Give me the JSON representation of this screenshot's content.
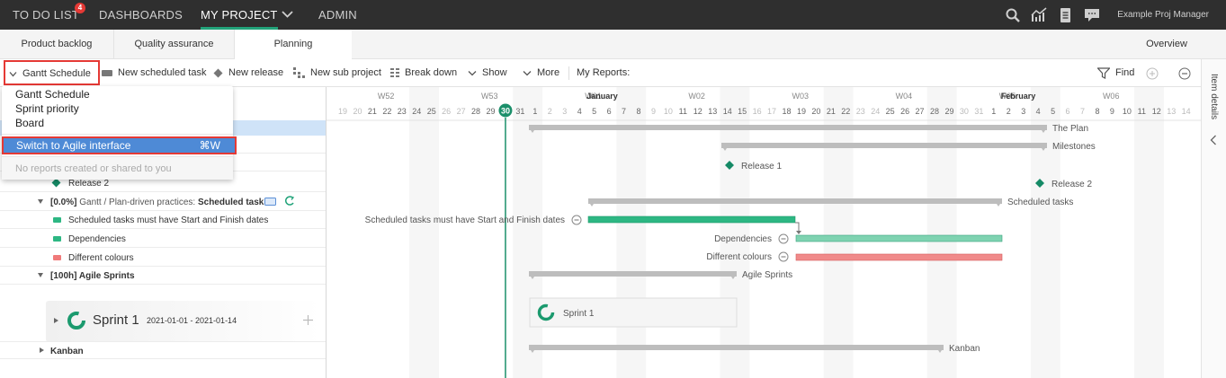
{
  "topbar": {
    "todo": "TO DO LIST",
    "todo_badge": "4",
    "dashboards": "DASHBOARDS",
    "my_project": "MY PROJECT",
    "admin": "ADMIN",
    "user": "Example Proj Manager",
    "icons": [
      "search-icon",
      "analytics-icon",
      "document-icon",
      "chat-icon"
    ],
    "accent": "#22a37a"
  },
  "tabs": [
    "Product backlog",
    "Quality assurance",
    "Planning",
    "Overview"
  ],
  "active_tab": "Planning",
  "toolbar": {
    "gantt_schedule": "Gantt Schedule",
    "new_scheduled_task": "New scheduled task",
    "new_release": "New release",
    "new_sub_project": "New sub project",
    "break_down": "Break down",
    "show": "Show",
    "more": "More",
    "my_reports": "My Reports:",
    "find": "Find"
  },
  "dropdown": {
    "items": [
      "Gantt Schedule",
      "Sprint priority",
      "Board"
    ],
    "switch_label": "Switch to Agile interface",
    "switch_shortcut": "⌘W",
    "empty": "No reports created or shared to you"
  },
  "left": {
    "release2": "Release 2",
    "group_progress": "[0.0%]",
    "group_path": "Gantt / Plan-driven practices:",
    "group_name": "Scheduled tasks",
    "task1": "Scheduled tasks must have Start and Finish dates",
    "task2": "Dependencies",
    "task3": "Different colours",
    "agile": "[100h] Agile Sprints",
    "sprint_name": "Sprint 1",
    "sprint_dates": "2021-01-01 - 2021-01-14",
    "kanban": "Kanban"
  },
  "timeline": {
    "weeks": [
      "W52",
      "W53",
      "W01",
      "W02",
      "W03",
      "W04",
      "W05",
      "W06"
    ],
    "months": [
      "January",
      "February"
    ],
    "days": [
      19,
      20,
      21,
      22,
      23,
      24,
      25,
      26,
      27,
      28,
      29,
      30,
      31,
      1,
      2,
      3,
      4,
      5,
      6,
      7,
      8,
      9,
      10,
      11,
      12,
      13,
      14,
      15,
      16,
      17,
      18,
      19,
      20,
      21,
      22,
      23,
      24,
      25,
      26,
      27,
      28,
      29,
      30,
      31,
      1,
      2,
      3,
      4,
      5,
      6,
      7,
      8,
      9,
      10,
      11,
      12,
      13,
      14
    ],
    "today": "30"
  },
  "chart_labels": {
    "the_plan": "The Plan",
    "milestones": "Milestones",
    "release1": "Release 1",
    "release2": "Release 2",
    "scheduled_tasks": "Scheduled tasks",
    "task1": "Scheduled tasks must have Start and Finish dates",
    "dependencies": "Dependencies",
    "different_colours": "Different colours",
    "agile_sprints": "Agile Sprints",
    "sprint1": "Sprint 1",
    "kanban": "Kanban"
  },
  "right_panel": {
    "label": "Item details"
  },
  "colors": {
    "green": "#2db783",
    "green_light": "#7fd3b1",
    "red": "#f08a8a",
    "gray_bar": "#bdbdbd",
    "today": "#1b8f6a",
    "select": "#4e8ad6"
  }
}
